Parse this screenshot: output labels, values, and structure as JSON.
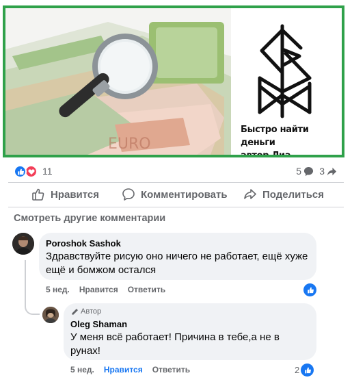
{
  "post": {
    "caption_line1": "Быстро найти деньги",
    "caption_line2": "автор Лиа",
    "frame_color": "#2fa14a"
  },
  "reactions": {
    "count": "11",
    "comments_count": "5",
    "shares_count": "3",
    "icons": [
      "like-icon",
      "love-icon"
    ]
  },
  "actions": {
    "like_label": "Нравится",
    "comment_label": "Комментировать",
    "share_label": "Поделиться"
  },
  "comments_section": {
    "more_label": "Смотреть другие комментарии"
  },
  "comments": [
    {
      "author": "Poroshok Sashok",
      "text": "Здравствуйте рисую оно ничего не работает, ещё хуже ещё и бомжом остался",
      "time": "5 нед.",
      "like_label": "Нравится",
      "reply_label": "Ответить"
    },
    {
      "badge": "Автор",
      "author": "Oleg Shaman",
      "text": "У меня всё работает! Причина в тебе,а не в рунах!",
      "time": "5 нед.",
      "like_label": "Нравится",
      "reply_label": "Ответить",
      "like_count": "2"
    }
  ],
  "colors": {
    "accent": "#1877f2",
    "love": "#f33e58",
    "muted": "#65676b",
    "bubble": "#f0f2f5"
  }
}
